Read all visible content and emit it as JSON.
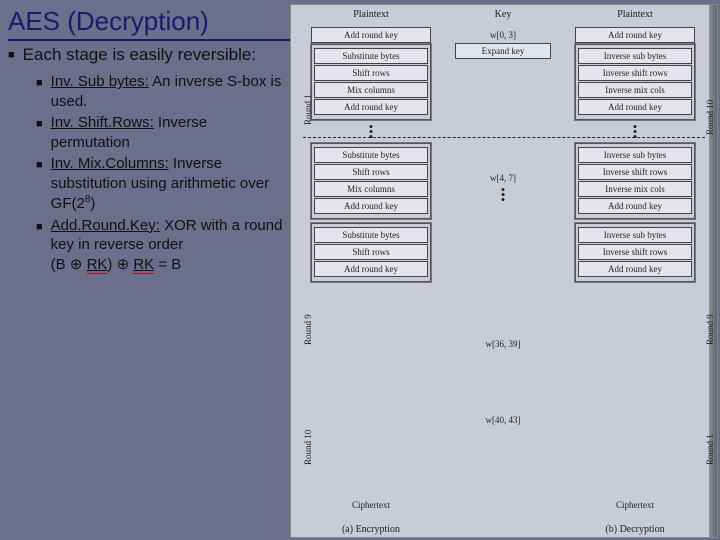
{
  "title": "AES (Decryption)",
  "bullet_main": "Each stage is easily reversible:",
  "stages": [
    {
      "name": "Inv. Sub bytes:",
      "desc": " An inverse S-box is used."
    },
    {
      "name": "Inv. Shift.Rows:",
      "desc": " Inverse permutation"
    },
    {
      "name": "Inv. Mix.Columns:",
      "desc": " Inverse substitution using arithmetic over GF(2"
    },
    {
      "name": "Add.Round.Key:",
      "desc": " XOR with a round key in reverse order"
    }
  ],
  "gf_sup": "8",
  "gf_tail": ")",
  "equation_b1": "(B ⊕ ",
  "equation_rk1": "RK",
  "equation_mid": ") ⊕ ",
  "equation_rk2": "RK",
  "equation_end": " = B",
  "diagram": {
    "headers": {
      "left": "Plaintext",
      "mid": "Key",
      "right": "Plaintext"
    },
    "enc": {
      "pre": "Add round key",
      "r1": [
        "Substitute bytes",
        "Shift rows",
        "Mix columns",
        "Add round key"
      ],
      "r9": [
        "Substitute bytes",
        "Shift rows",
        "Mix columns",
        "Add round key"
      ],
      "r10": [
        "Substitute bytes",
        "Shift rows",
        "Add round key"
      ],
      "caption": "(a) Encryption",
      "out": "Ciphertext",
      "round_labels": [
        "Round 1",
        "Round 9",
        "Round 10"
      ]
    },
    "keys": {
      "w0": "w[0, 3]",
      "expand": "Expand key",
      "w1": "w[4, 7]",
      "w9": "w[36, 39]",
      "w10": "w[40, 43]"
    },
    "dec": {
      "pre": "Add round key",
      "r10": [
        "Inverse sub bytes",
        "Inverse shift rows",
        "Inverse mix cols",
        "Add round key"
      ],
      "r9": [
        "Inverse sub bytes",
        "Inverse shift rows",
        "Inverse mix cols",
        "Add round key"
      ],
      "r1": [
        "Inverse sub bytes",
        "Inverse shift rows",
        "Add round key"
      ],
      "caption": "(b) Decryption",
      "out": "Ciphertext",
      "round_labels": [
        "Round 10",
        "Round 9",
        "Round 1"
      ]
    }
  }
}
